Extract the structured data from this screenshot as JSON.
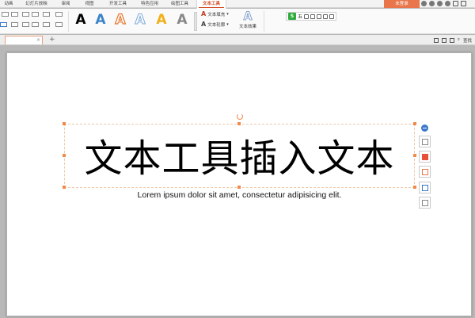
{
  "tabs": [
    {
      "label": "动画"
    },
    {
      "label": "幻灯片放映"
    },
    {
      "label": "审阅"
    },
    {
      "label": "视图"
    },
    {
      "label": "开发工具"
    },
    {
      "label": "特色应用"
    },
    {
      "label": "绘图工具"
    },
    {
      "label": "文本工具"
    }
  ],
  "login_label": "未登录",
  "wordart_glyph": "A",
  "ribbon": {
    "text_fill": "文本填充",
    "text_outline": "文本轮廓",
    "text_effect": "文本效果"
  },
  "ime": {
    "logo": "S",
    "mode": "五"
  },
  "doc": {
    "close": "×",
    "add": "+",
    "right_label": "查找"
  },
  "slide": {
    "title": "文本工具插入文本",
    "subtitle": "Lorem ipsum dolor sit amet, consectetur adipisicing elit."
  },
  "colors": {
    "accent": "#d04a1f",
    "login": "#e8764a",
    "handle": "#f08a4b",
    "blue": "#3b78c9"
  }
}
